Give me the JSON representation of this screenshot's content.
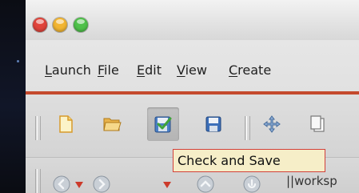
{
  "colors": {
    "accent_line": "#c44a2d",
    "close_button": "#e0443b",
    "minimize_button": "#f2b532",
    "maximize_button": "#4fc14a",
    "tooltip_bg": "#f6eec8",
    "tooltip_border": "#d2403a"
  },
  "menubar": {
    "items": [
      {
        "accel": "L",
        "rest": "aunch"
      },
      {
        "accel": "F",
        "rest": "ile"
      },
      {
        "accel": "E",
        "rest": "dit"
      },
      {
        "accel": "V",
        "rest": "iew"
      },
      {
        "accel": "C",
        "rest": "reate"
      }
    ]
  },
  "toolbar": {
    "icons": [
      "new-file-icon",
      "open-folder-icon",
      "check-and-save-icon",
      "save-icon",
      "move-icon",
      "copy-icon"
    ]
  },
  "tooltip": {
    "text": "Check and Save"
  },
  "nav": {
    "icons": [
      "back-icon",
      "forward-icon",
      "up-icon",
      "refresh-icon"
    ],
    "path_text": "||worksp"
  }
}
